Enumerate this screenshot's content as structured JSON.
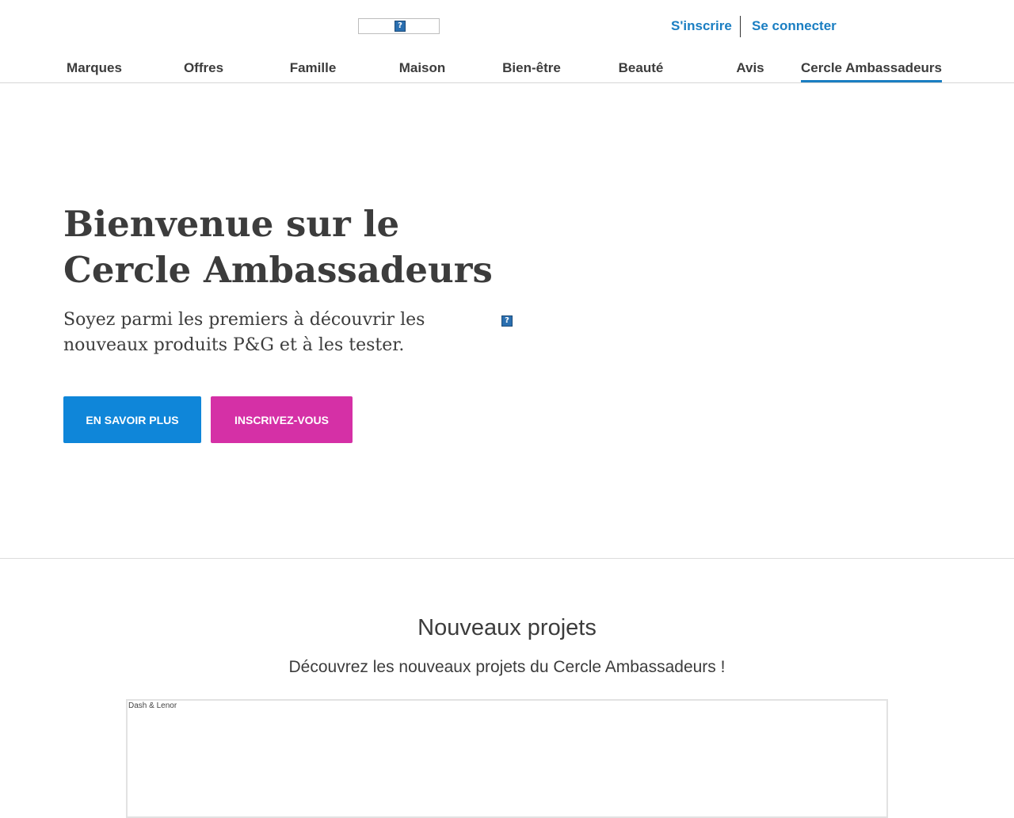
{
  "header": {
    "auth": {
      "signup": "S'inscrire",
      "login": "Se connecter"
    },
    "nav": [
      "Marques",
      "Offres",
      "Famille",
      "Maison",
      "Bien-être",
      "Beauté",
      "Avis",
      "Cercle Ambassadeurs"
    ],
    "active_nav": "Cercle Ambassadeurs"
  },
  "hero": {
    "title_line1": "Bienvenue sur le",
    "title_line2": "Cercle Ambassadeurs",
    "subtitle_line1": "Soyez parmi les premiers à découvrir les",
    "subtitle_line2": "nouveaux produits P&G et à les tester.",
    "btn_more": "EN SAVOIR PLUS",
    "btn_join": "INSCRIVEZ-VOUS"
  },
  "projects": {
    "title": "Nouveaux projets",
    "subtitle": "Découvrez les nouveaux projets du Cercle Ambassadeurs !",
    "card_alt": "Dash & Lenor"
  },
  "icons": {
    "broken_image": "broken-image-icon"
  },
  "colors": {
    "link": "#1a7ec2",
    "btn_more": "#0f86d9",
    "btn_join": "#d530a6",
    "text": "#3c3c3c"
  }
}
